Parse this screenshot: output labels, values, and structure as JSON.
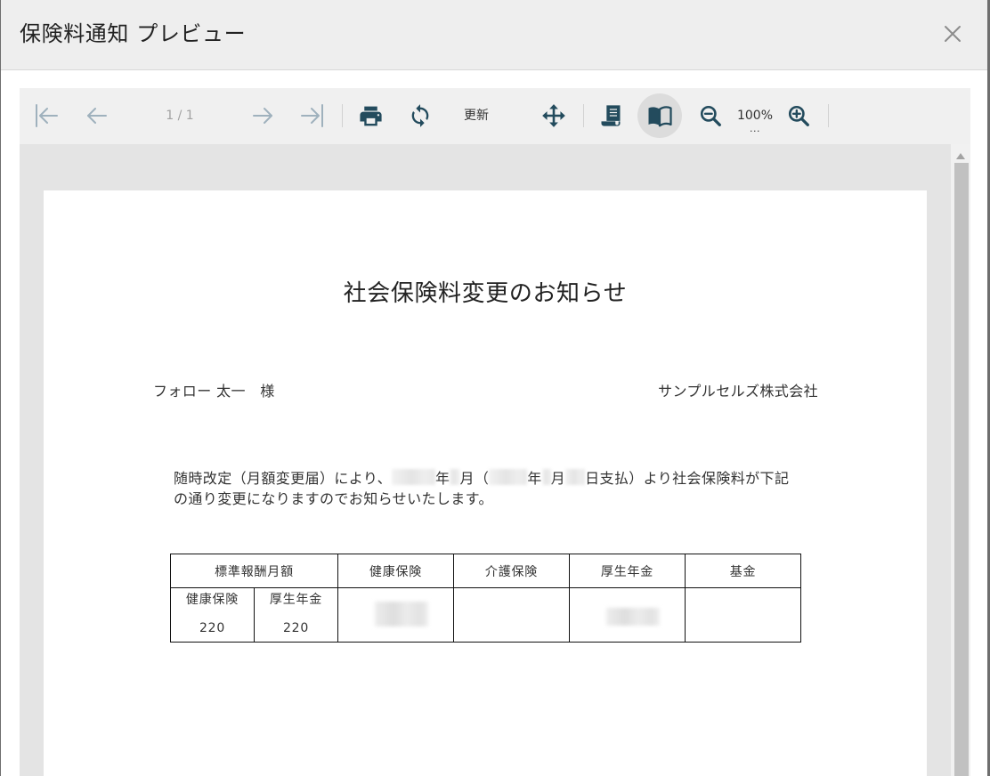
{
  "window": {
    "title": "保険料通知 プレビュー",
    "close_icon": "close-icon"
  },
  "toolbar": {
    "first_page_icon": "first-page-icon",
    "previous_page_icon": "arrow-left-icon",
    "page_indicator": "1 / 1",
    "next_page_icon": "arrow-right-icon",
    "last_page_icon": "last-page-icon",
    "print_icon": "print-icon",
    "refresh_icon": "refresh-icon",
    "refresh_label": "更新",
    "pan_icon": "move-icon",
    "continuous_view_icon": "scroll-icon",
    "book_view_icon": "book-icon",
    "book_view_active": true,
    "zoom_out_icon": "zoom-out-icon",
    "zoom_level": "100%",
    "zoom_overflow": "...",
    "zoom_in_icon": "zoom-in-icon"
  },
  "document": {
    "title": "社会保険料変更のお知らせ",
    "recipient": "フォロー 太一　様",
    "sender": "サンプルセルズ株式会社",
    "body_line1": [
      "随時改定（月額変更届）により、",
      "年",
      "月（",
      "年",
      "月",
      "日支払）より社会保険料が下記"
    ],
    "body_line2": "の通り変更になりますのでお知らせいたします。",
    "table": {
      "headers": [
        "標準報酬月額",
        "健康保険",
        "介護保険",
        "厚生年金",
        "基金"
      ],
      "standard_monthly": [
        {
          "label": "健康保険",
          "value": "220"
        },
        {
          "label": "厚生年金",
          "value": "220"
        }
      ]
    }
  },
  "scrollbar": {
    "up_arrow_icon": "scroll-up-arrow-icon"
  },
  "colors": {
    "header_bg": "#eeeeee",
    "toolbar_bg": "#f0f0f0",
    "viewer_bg": "#e4e4e4",
    "icon_enabled": "#234b5d",
    "icon_disabled": "#9fb1bd",
    "active_button_bg": "#dcdcdc"
  }
}
